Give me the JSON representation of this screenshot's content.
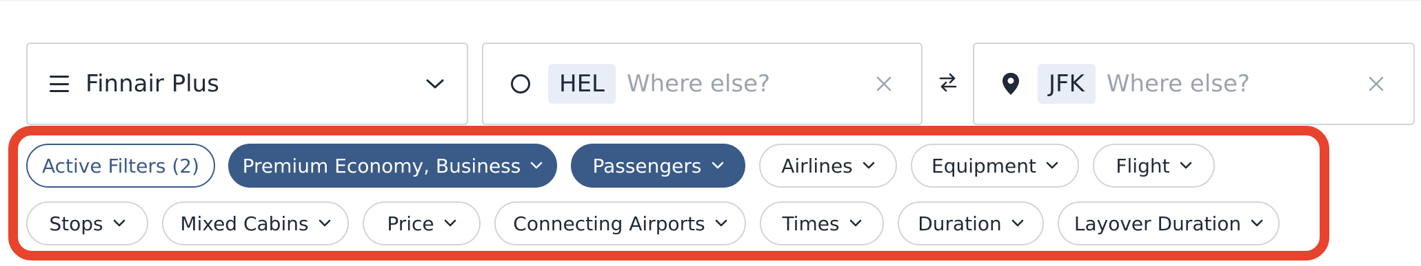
{
  "search": {
    "program": "Finnair Plus",
    "origin_code": "HEL",
    "origin_placeholder": "Where else?",
    "destination_code": "JFK",
    "destination_placeholder": "Where else?"
  },
  "filters": {
    "active_filters": "Active Filters (2)",
    "row1": [
      "Premium Economy, Business",
      "Passengers",
      "Airlines",
      "Equipment",
      "Flight"
    ],
    "row2": [
      "Stops",
      "Mixed Cabins",
      "Price",
      "Connecting Airports",
      "Times",
      "Duration",
      "Layover Duration"
    ]
  },
  "colors": {
    "accent": "#3a5a87",
    "highlight": "#e8432d",
    "chip_bg": "#e8edf7"
  },
  "icons": {
    "menu": "hamburger-icon",
    "origin": "circle-icon",
    "destination": "map-pin-icon",
    "swap": "swap-icon",
    "clear": "close-icon",
    "dropdown": "chevron-down-icon"
  }
}
